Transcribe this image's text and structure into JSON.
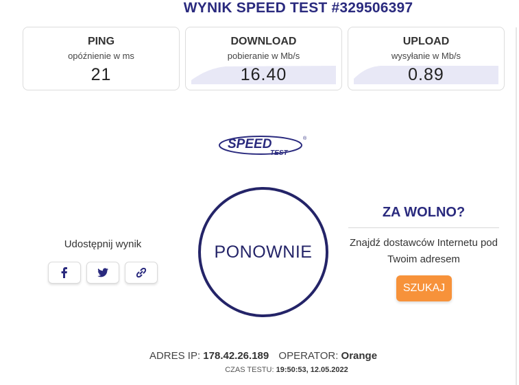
{
  "header": {
    "title": "WYNIK SPEED TEST #329506397"
  },
  "cards": [
    {
      "title": "PING",
      "subtitle": "opóźnienie w ms",
      "value": "21"
    },
    {
      "title": "DOWNLOAD",
      "subtitle": "pobieranie w Mb/s",
      "value": "16.40"
    },
    {
      "title": "UPLOAD",
      "subtitle": "wysyłanie w Mb/s",
      "value": "0.89"
    }
  ],
  "logo": {
    "text_main": "SPEED",
    "text_sub": "TEST",
    "mark": "®"
  },
  "retest": {
    "label": "PONOWNIE"
  },
  "share": {
    "label": "Udostępnij wynik",
    "buttons": [
      {
        "icon": "facebook-icon"
      },
      {
        "icon": "twitter-icon"
      },
      {
        "icon": "link-icon"
      }
    ]
  },
  "slow": {
    "title": "ZA WOLNO?",
    "text": "Znajdź dostawców Internetu pod Twoim adresem",
    "button": "SZUKAJ"
  },
  "footer": {
    "ip_label": "ADRES IP:",
    "ip_value": "178.42.26.189",
    "operator_label": "OPERATOR:",
    "operator_value": "Orange",
    "time_label": "CZAS TESTU:",
    "time_value": "19:50:53, 12.05.2022"
  },
  "colors": {
    "accent": "#2a2a7e",
    "button": "#f7923a",
    "sparkline": "#e8e8f6"
  }
}
